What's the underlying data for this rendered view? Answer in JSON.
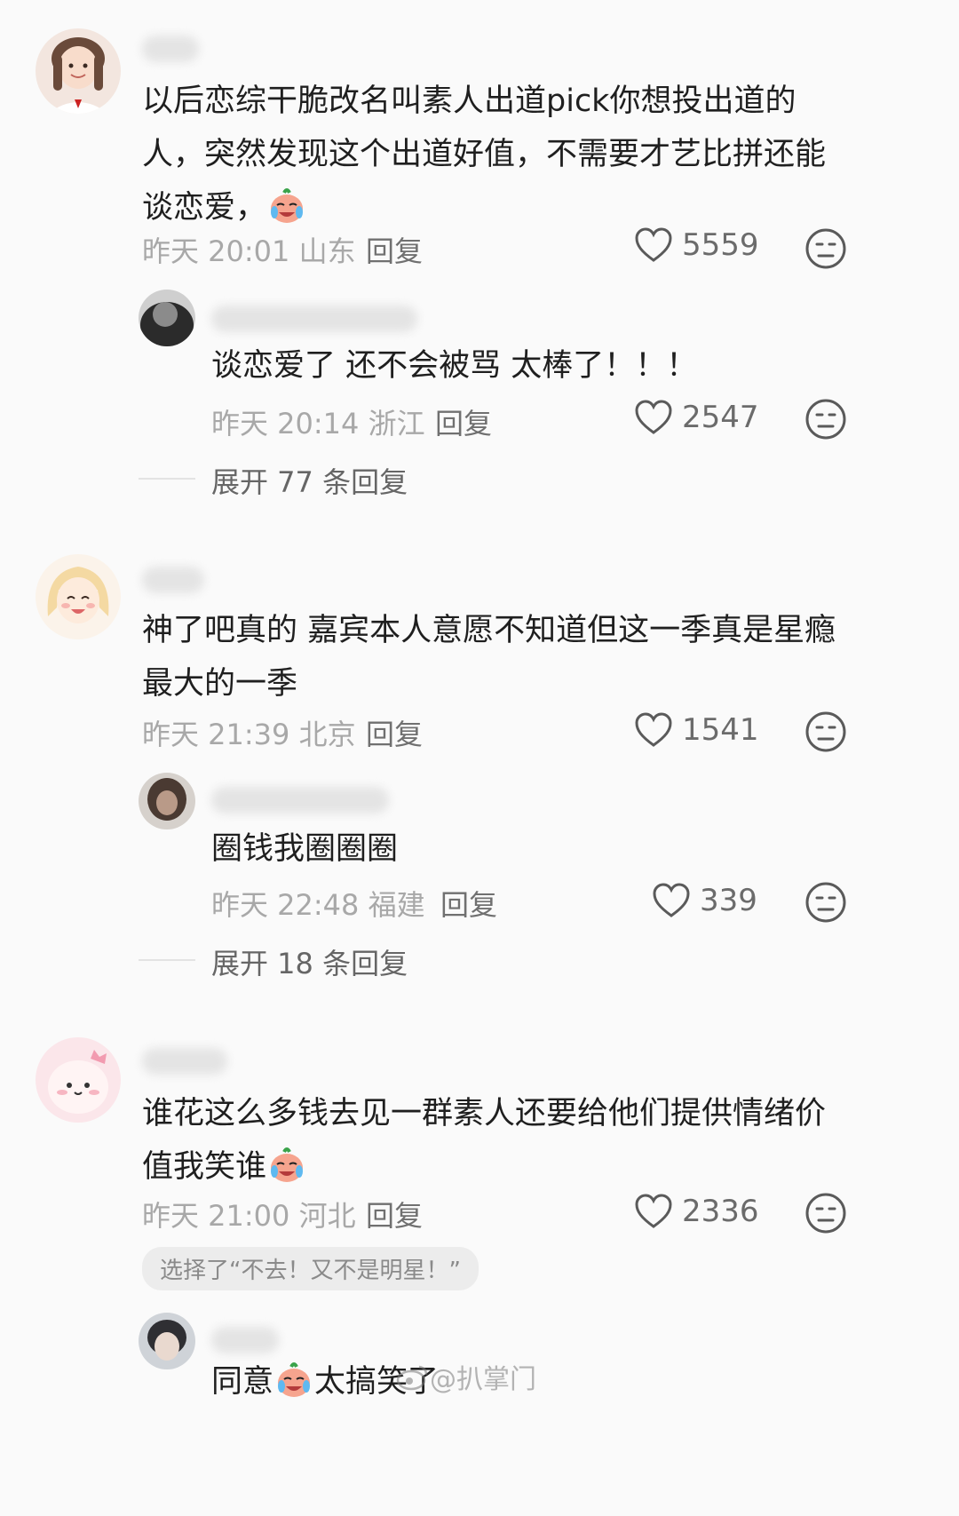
{
  "comments": [
    {
      "text": "以后恋综干脆改名叫素人出道pick你想投出道的人，突然发现这个出道好值，不需要才艺比拼还能谈恋爱，",
      "emoji": "crying-laughing-emoji",
      "time": "昨天 20:01",
      "location": "山东",
      "reply_label": "回复",
      "likes": "5559",
      "replies": [
        {
          "text": "谈恋爱了 还不会被骂 太棒了！！！",
          "time": "昨天 20:14",
          "location": "浙江",
          "reply_label": "回复",
          "likes": "2547"
        }
      ],
      "expand_label": "展开 77 条回复"
    },
    {
      "text": "神了吧真的 嘉宾本人意愿不知道但这一季真是星瘾最大的一季",
      "time": "昨天 21:39",
      "location": "北京",
      "reply_label": "回复",
      "likes": "1541",
      "replies": [
        {
          "text": "圈钱我圈圈圈",
          "time": "昨天 22:48",
          "location": "福建",
          "reply_label": "回复",
          "likes": "339"
        }
      ],
      "expand_label": "展开 18 条回复"
    },
    {
      "text": "谁花这么多钱去见一群素人还要给他们提供情绪价值我笑谁",
      "emoji": "crying-laughing-emoji",
      "time": "昨天 21:00",
      "location": "河北",
      "reply_label": "回复",
      "likes": "2336",
      "vote": "选择了“不去！又不是明星！”",
      "replies": [
        {
          "text": "同意",
          "text_after": "太搞笑了"
        }
      ]
    }
  ],
  "watermark": "@扒掌门",
  "icons": {
    "like": "heart-outline-icon",
    "dislike": "neutral-face-icon"
  },
  "colors": {
    "background": "#fafafa",
    "text": "#1f1f1f",
    "meta": "#a8a8a8",
    "reply": "#707070"
  }
}
